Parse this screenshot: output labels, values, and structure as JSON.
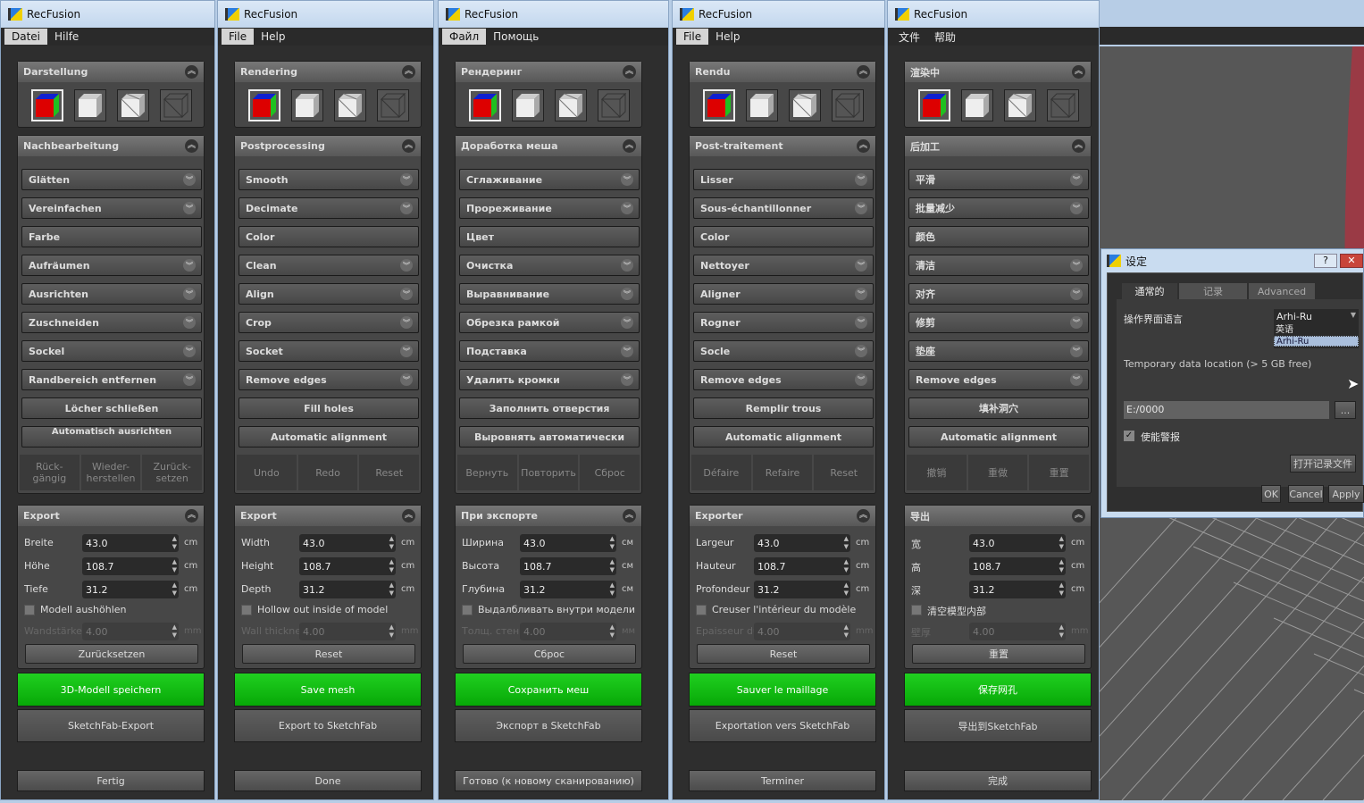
{
  "common": {
    "width": "43.0",
    "height": "108.7",
    "depth": "31.2",
    "wall": "4.00"
  },
  "panels": [
    {
      "title": "RecFusion",
      "menu": [
        "Datei",
        "Hilfe"
      ],
      "display": "Darstellung",
      "post": {
        "title": "Nachbearbeitung",
        "items": [
          {
            "label": "Glätten",
            "chevron": true
          },
          {
            "label": "Vereinfachen",
            "chevron": true
          },
          {
            "label": "Farbe",
            "chevron": false
          },
          {
            "label": "Aufräumen",
            "chevron": true
          },
          {
            "label": "Ausrichten",
            "chevron": true
          },
          {
            "label": "Zuschneiden",
            "chevron": true
          },
          {
            "label": "Sockel",
            "chevron": true
          },
          {
            "label": "Randbereich entfernen",
            "chevron": true
          }
        ],
        "fill_holes": "Löcher schließen",
        "auto_align": "Automatisch ausrichten",
        "undo": "Rück-gängig",
        "redo": "Wieder-herstellen",
        "reset": "Zurück-setzen"
      },
      "export": {
        "title": "Export",
        "width": "Breite",
        "height": "Höhe",
        "depth": "Tiefe",
        "unit": "cm",
        "hollow": "Modell aushöhlen",
        "wall": "Wandstärke",
        "wall_unit": "mm",
        "reset": "Zurücksetzen"
      },
      "save": "3D-Modell speichern",
      "sketchfab": "SketchFab-Export",
      "done": "Fertig"
    },
    {
      "title": "RecFusion",
      "menu": [
        "File",
        "Help"
      ],
      "display": "Rendering",
      "post": {
        "title": "Postprocessing",
        "items": [
          {
            "label": "Smooth",
            "chevron": true
          },
          {
            "label": "Decimate",
            "chevron": true
          },
          {
            "label": "Color",
            "chevron": false
          },
          {
            "label": "Clean",
            "chevron": true
          },
          {
            "label": "Align",
            "chevron": true
          },
          {
            "label": "Crop",
            "chevron": true
          },
          {
            "label": "Socket",
            "chevron": true
          },
          {
            "label": "Remove edges",
            "chevron": true
          }
        ],
        "fill_holes": "Fill holes",
        "auto_align": "Automatic alignment",
        "undo": "Undo",
        "redo": "Redo",
        "reset": "Reset"
      },
      "export": {
        "title": "Export",
        "width": "Width",
        "height": "Height",
        "depth": "Depth",
        "unit": "cm",
        "hollow": "Hollow out inside of model",
        "wall": "Wall thickness",
        "wall_unit": "mm",
        "reset": "Reset"
      },
      "save": "Save mesh",
      "sketchfab": "Export to SketchFab",
      "done": "Done"
    },
    {
      "title": "RecFusion",
      "menu": [
        "Файл",
        "Помощь"
      ],
      "display": "Рендеринг",
      "post": {
        "title": "Доработка меша",
        "items": [
          {
            "label": "Сглаживание",
            "chevron": true
          },
          {
            "label": "Прореживание",
            "chevron": true
          },
          {
            "label": "Цвет",
            "chevron": false
          },
          {
            "label": "Очистка",
            "chevron": true
          },
          {
            "label": "Выравнивание",
            "chevron": true
          },
          {
            "label": "Обрезка рамкой",
            "chevron": true
          },
          {
            "label": "Подставка",
            "chevron": true
          },
          {
            "label": "Удалить кромки",
            "chevron": true
          }
        ],
        "fill_holes": "Заполнить отверстия",
        "auto_align": "Выровнять автоматически",
        "undo": "Вернуть",
        "redo": "Повторить",
        "reset": "Сброс"
      },
      "export": {
        "title": "При экспорте",
        "width": "Ширина",
        "height": "Высота",
        "depth": "Глубина",
        "unit": "см",
        "hollow": "Выдалбливать внутри модели",
        "wall": "Толщ. стенки",
        "wall_unit": "мм",
        "reset": "Сброс"
      },
      "save": "Сохранить меш",
      "sketchfab": "Экспорт в SketchFab",
      "done": "Готово (к новому сканированию)"
    },
    {
      "title": "RecFusion",
      "menu": [
        "File",
        "Help"
      ],
      "display": "Rendu",
      "post": {
        "title": "Post-traitement",
        "items": [
          {
            "label": "Lisser",
            "chevron": true
          },
          {
            "label": "Sous-échantillonner",
            "chevron": true
          },
          {
            "label": "Color",
            "chevron": false
          },
          {
            "label": "Nettoyer",
            "chevron": true
          },
          {
            "label": "Aligner",
            "chevron": true
          },
          {
            "label": "Rogner",
            "chevron": true
          },
          {
            "label": "Socle",
            "chevron": true
          },
          {
            "label": "Remove edges",
            "chevron": true
          }
        ],
        "fill_holes": "Remplir trous",
        "auto_align": "Automatic alignment",
        "undo": "Défaire",
        "redo": "Refaire",
        "reset": "Reset"
      },
      "export": {
        "title": "Exporter",
        "width": "Largeur",
        "height": "Hauteur",
        "depth": "Profondeur",
        "unit": "cm",
        "hollow": "Creuser l'intérieur du modèle",
        "wall": "Epaisseur du mur",
        "wall_unit": "mm",
        "reset": "Reset"
      },
      "save": "Sauver le maillage",
      "sketchfab": "Exportation vers SketchFab",
      "done": "Terminer"
    },
    {
      "title": "RecFusion",
      "menu": [
        "文件",
        "帮助"
      ],
      "display": "渲染中",
      "post": {
        "title": "后加工",
        "items": [
          {
            "label": "平滑",
            "chevron": true
          },
          {
            "label": "批量减少",
            "chevron": true
          },
          {
            "label": "颜色",
            "chevron": false
          },
          {
            "label": "清洁",
            "chevron": true
          },
          {
            "label": "对齐",
            "chevron": true
          },
          {
            "label": "修剪",
            "chevron": true
          },
          {
            "label": "垫座",
            "chevron": true
          },
          {
            "label": "Remove edges",
            "chevron": true
          }
        ],
        "fill_holes": "填补洞穴",
        "auto_align": "Automatic alignment",
        "undo": "撤销",
        "redo": "重做",
        "reset": "重置"
      },
      "export": {
        "title": "导出",
        "width": "宽",
        "height": "高",
        "depth": "深",
        "unit": "cm",
        "hollow": "清空模型内部",
        "wall": "壁厚",
        "wall_unit": "mm",
        "reset": "重置"
      },
      "save": "保存网孔",
      "sketchfab": "导出到SketchFab",
      "done": "完成"
    }
  ],
  "dialog": {
    "title": "设定",
    "help": "?",
    "close": "✕",
    "tabs": [
      "通常的",
      "记录",
      "Advanced"
    ],
    "language_label": "操作界面语言",
    "language_value": "Arhi-Ru",
    "language_options": [
      "英语",
      "Arhi-Ru"
    ],
    "temp_label": "Temporary data location (> 5 GB free)",
    "temp_path": "E:/0000",
    "browse": "...",
    "alarm": "使能警报",
    "alarm_checked": true,
    "open_log": "打开记录文件",
    "ok": "OK",
    "cancel": "Cancel",
    "apply": "Apply"
  },
  "colors": {
    "save_green": "#10c010",
    "dark_bg": "#2e2e2e",
    "viewport_object": "#9a3a45"
  }
}
